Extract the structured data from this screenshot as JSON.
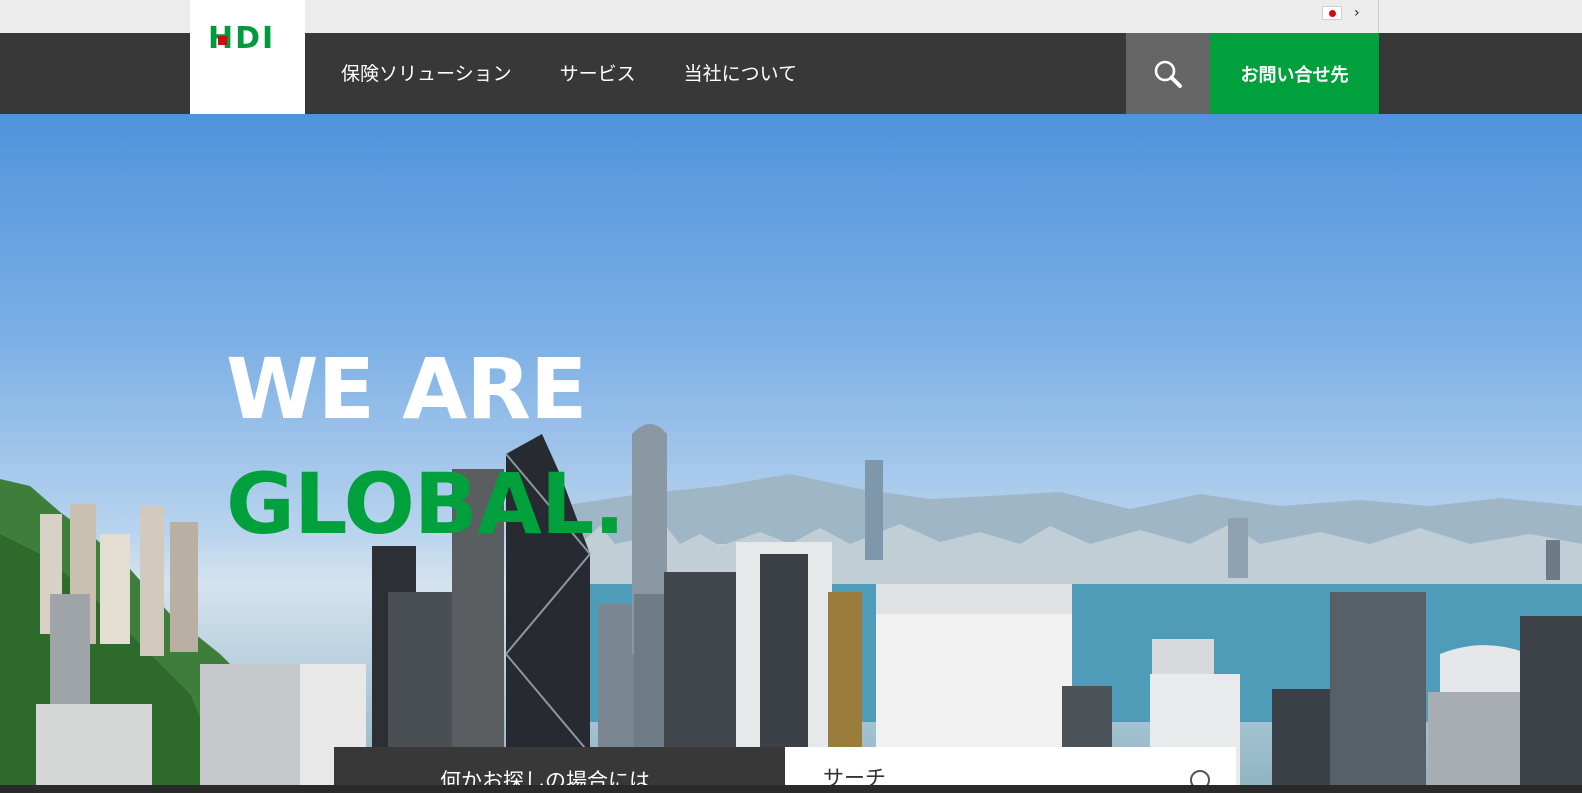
{
  "brand": {
    "logo_text": "HDI",
    "primary_color": "#00a03c",
    "accent_color": "#d10a11",
    "nav_color": "#383838"
  },
  "top_bar": {
    "language_flag": "japan-flag-icon",
    "chevron": "›"
  },
  "nav": {
    "items": [
      {
        "label": "保険ソリューション"
      },
      {
        "label": "サービス"
      },
      {
        "label": "当社について"
      }
    ],
    "search_icon": "search-icon",
    "contact_label": "お問い合せ先"
  },
  "hero": {
    "headline_line1": "WE ARE",
    "headline_line2": "GLOBAL."
  },
  "search_panel": {
    "label": "何かお探しの場合には",
    "placeholder": "サーチ",
    "icon": "search-icon"
  }
}
